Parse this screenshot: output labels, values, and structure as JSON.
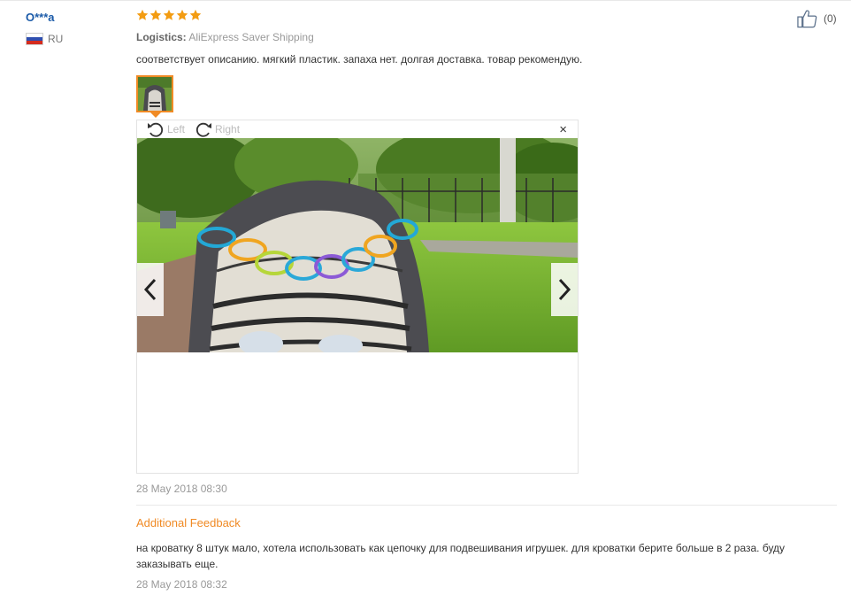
{
  "user": {
    "name": "O***a",
    "country_code": "RU"
  },
  "rating": {
    "stars": 5,
    "max": 5,
    "color": "#f39c12"
  },
  "logistics": {
    "label": "Logistics:",
    "value": "AliExpress Saver Shipping"
  },
  "review": {
    "text": "соответствует описанию. мягкий пластик. запаха нет. долгая доставка. товар рекомендую."
  },
  "like": {
    "count": "(0)"
  },
  "viewer": {
    "rotate_left_label": "Left",
    "rotate_right_label": "Right",
    "close_symbol": "×"
  },
  "dates": {
    "review_date": "28 May 2018 08:30",
    "additional_date": "28 May 2018 08:32"
  },
  "additional": {
    "title": "Additional Feedback",
    "text": "на кроватку 8 штук мало, хотела использовать как цепочку для подвешивания игрушек. для кроватки берите больше в 2 раза. буду заказывать еще."
  },
  "colors": {
    "accent": "#f08a24",
    "link": "#1a5aa8",
    "muted": "#999999"
  }
}
